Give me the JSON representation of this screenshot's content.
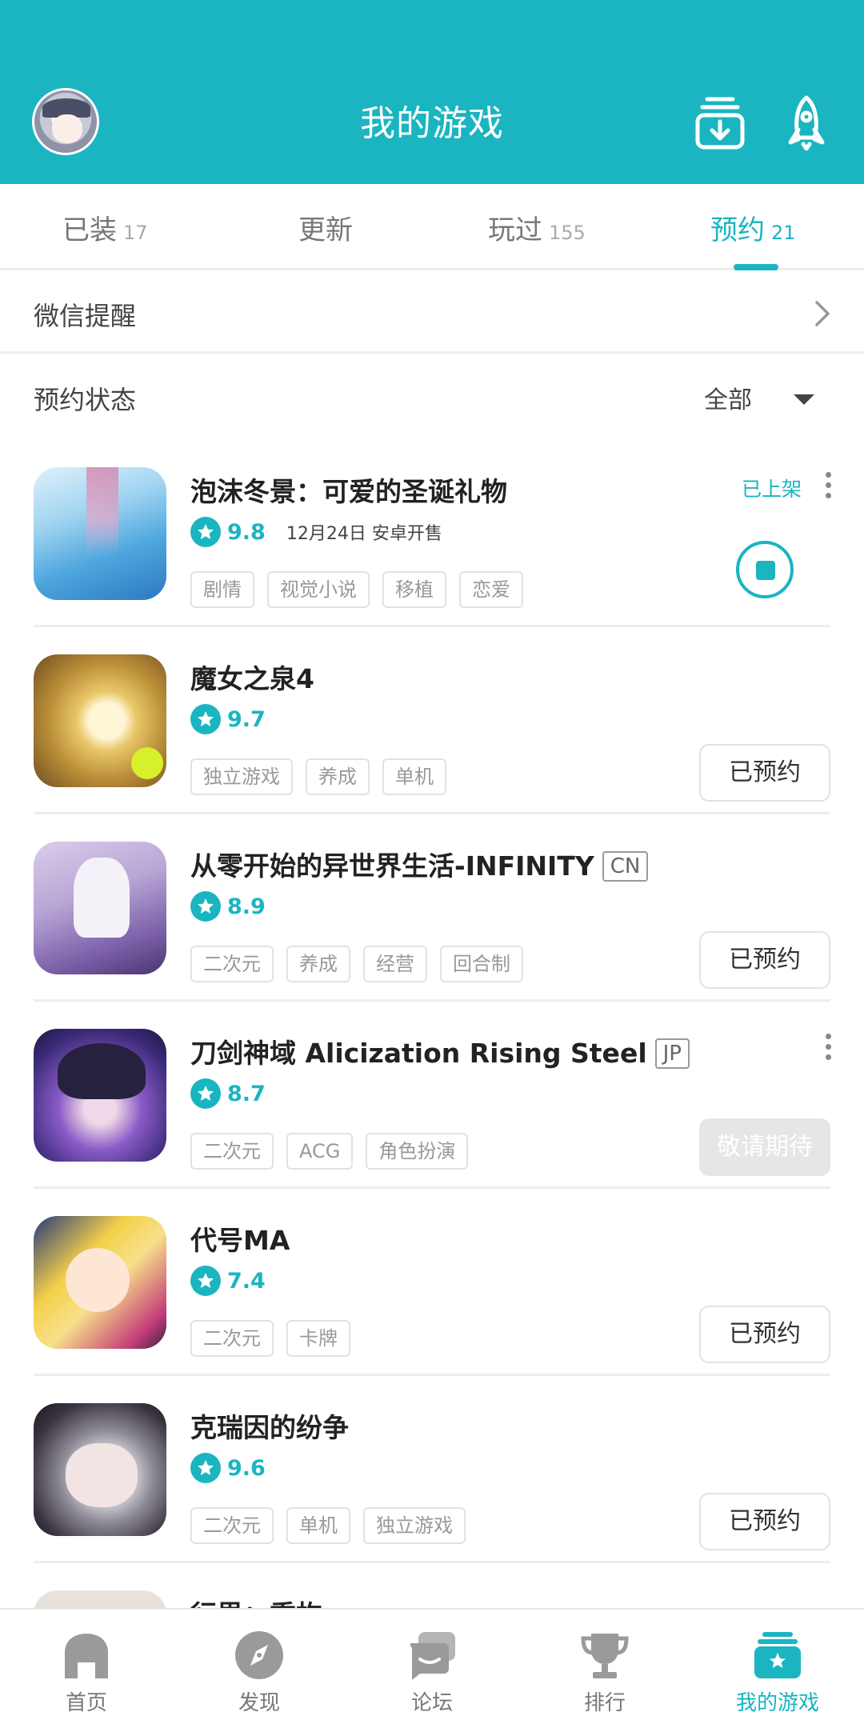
{
  "header": {
    "title": "我的游戏",
    "left": "avatar",
    "right_icons": [
      "download-box-icon",
      "rocket-icon"
    ]
  },
  "tabs": [
    {
      "label": "已装",
      "count": "17",
      "active": false
    },
    {
      "label": "更新",
      "count": "",
      "active": false
    },
    {
      "label": "玩过",
      "count": "155",
      "active": false
    },
    {
      "label": "预约",
      "count": "21",
      "active": true
    }
  ],
  "wechat": {
    "label": "微信提醒"
  },
  "status": {
    "label": "预约状态",
    "filter": "全部"
  },
  "games": [
    {
      "name": "泡沫冬景：可爱的圣诞礼物",
      "region": "",
      "score": "9.8",
      "date": "12月24日 安卓开售",
      "tags": [
        "剧情",
        "视觉小说",
        "移植",
        "恋爱"
      ],
      "status_text": "已上架",
      "button": ""
    },
    {
      "name": "魔女之泉4",
      "region": "",
      "score": "9.7",
      "date": "",
      "tags": [
        "独立游戏",
        "养成",
        "单机"
      ],
      "status_text": "",
      "button": "已预约"
    },
    {
      "name": "从零开始的异世界生活-INFINITY",
      "region": "CN",
      "score": "8.9",
      "date": "",
      "tags": [
        "二次元",
        "养成",
        "经营",
        "回合制"
      ],
      "status_text": "",
      "button": "已预约"
    },
    {
      "name": "刀剑神域 Alicization Rising Steel",
      "region": "JP",
      "score": "8.7",
      "date": "",
      "tags": [
        "二次元",
        "ACG",
        "角色扮演"
      ],
      "status_text": "",
      "button": "敬请期待"
    },
    {
      "name": "代号MA",
      "region": "",
      "score": "7.4",
      "date": "",
      "tags": [
        "二次元",
        "卡牌"
      ],
      "status_text": "",
      "button": "已预约"
    },
    {
      "name": "克瑞因的纷争",
      "region": "",
      "score": "9.6",
      "date": "",
      "tags": [
        "二次元",
        "单机",
        "独立游戏"
      ],
      "status_text": "",
      "button": "已预约"
    },
    {
      "name": "行界：重构",
      "region": "",
      "score": "",
      "date": "",
      "tags": [],
      "status_text": "",
      "button": ""
    }
  ],
  "bottom_nav": [
    {
      "label": "首页",
      "icon": "home-icon"
    },
    {
      "label": "发现",
      "icon": "compass-icon"
    },
    {
      "label": "论坛",
      "icon": "forum-icon"
    },
    {
      "label": "排行",
      "icon": "trophy-icon"
    },
    {
      "label": "我的游戏",
      "icon": "my-games-icon",
      "active": true
    }
  ],
  "colors": {
    "accent": "#1ab5c1"
  }
}
